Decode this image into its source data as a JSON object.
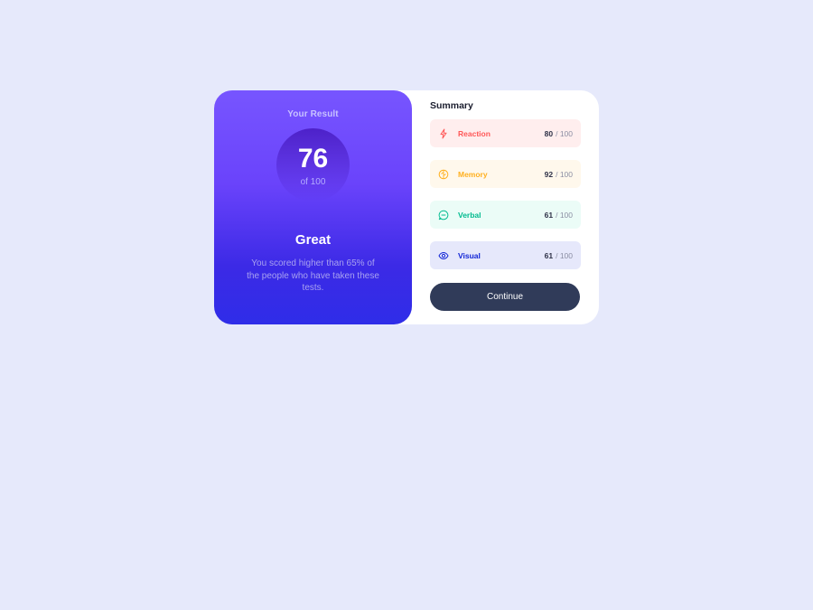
{
  "result": {
    "title": "Your Result",
    "score": "76",
    "score_of": "of 100",
    "rating": "Great",
    "description": "You scored higher than 65% of the people who have taken these tests."
  },
  "summary": {
    "title": "Summary",
    "items": [
      {
        "label": "Reaction",
        "score": "80",
        "total": "/ 100",
        "icon": "lightning-icon",
        "color": "#ff5757",
        "bg": "#ffeeee"
      },
      {
        "label": "Memory",
        "score": "92",
        "total": "/ 100",
        "icon": "brain-icon",
        "color": "#ffb01f",
        "bg": "#fff8ec"
      },
      {
        "label": "Verbal",
        "score": "61",
        "total": "/ 100",
        "icon": "chat-icon",
        "color": "#00bb8f",
        "bg": "#ebfcf7"
      },
      {
        "label": "Visual",
        "score": "61",
        "total": "/ 100",
        "icon": "eye-icon",
        "color": "#1125d6",
        "bg": "#e6e8fb"
      }
    ],
    "continue_label": "Continue"
  }
}
